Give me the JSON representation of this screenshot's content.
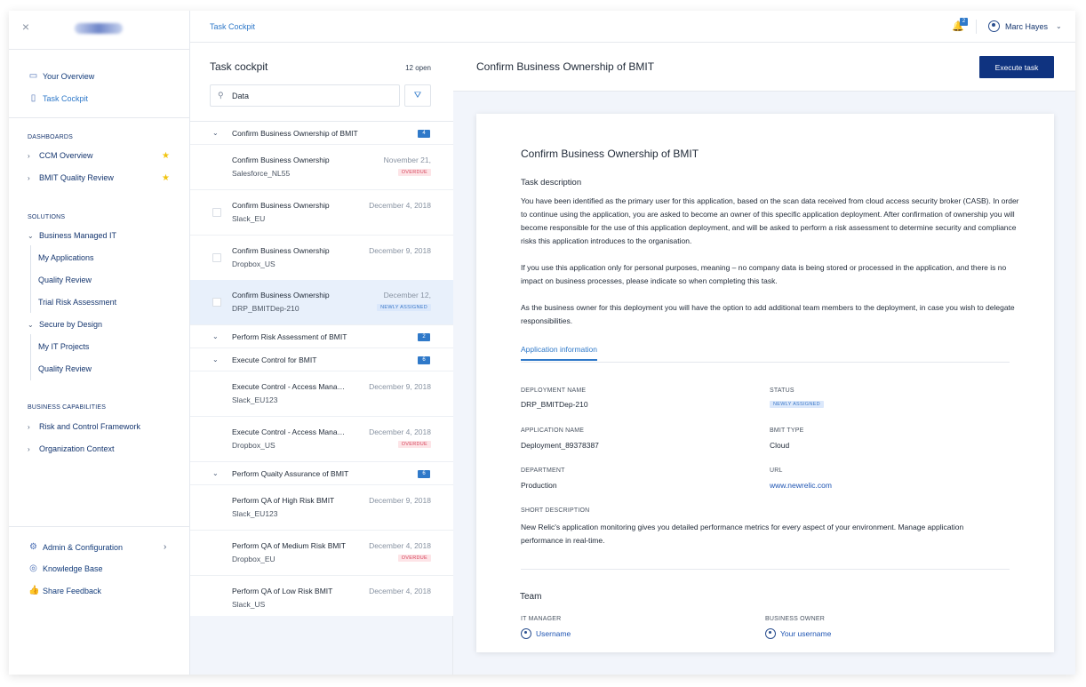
{
  "sidebar": {
    "close_icon": "×",
    "main_nav": [
      {
        "label": "Your Overview",
        "icon": "overview-icon"
      },
      {
        "label": "Task Cockpit",
        "icon": "task-icon"
      }
    ],
    "dashboards_heading": "DASHBOARDS",
    "dashboards": [
      {
        "label": "CCM Overview",
        "starred": true
      },
      {
        "label": "BMIT Quality Review",
        "starred": true
      }
    ],
    "solutions_heading": "SOLUTIONS",
    "solutions": {
      "business_managed_it": {
        "label": "Business Managed IT",
        "children": [
          "My Applications",
          "Quality Review",
          "Trial Risk Assessment"
        ]
      },
      "secure_by_design": {
        "label": "Secure by Design",
        "children": [
          "My IT Projects",
          "Quality Review"
        ]
      }
    },
    "capabilities_heading": "BUSINESS CAPABILITIES",
    "capabilities": [
      "Risk and Control Framework",
      "Organization Context"
    ],
    "footer": [
      {
        "label": "Admin & Configuration",
        "icon": "sliders-icon"
      },
      {
        "label": "Knowledge Base",
        "icon": "compass-icon"
      },
      {
        "label": "Share Feedback",
        "icon": "thumbs-up-icon"
      }
    ]
  },
  "header": {
    "breadcrumb": "Task Cockpit",
    "notification_count": "2",
    "user_name": "Marc Hayes"
  },
  "list": {
    "title": "Task cockpit",
    "count": "12 open",
    "search_value": "Data",
    "groups": [
      {
        "title": "Confirm Business Ownership of BMIT",
        "count": "4"
      },
      {
        "title": "Perform Risk Assessment of BMIT",
        "count": "2"
      },
      {
        "title": "Execute Control for BMIT",
        "count": "6"
      },
      {
        "title": "Perform Quaity Assurance of BMIT",
        "count": "6"
      }
    ],
    "items": [
      {
        "title": "Confirm Business Ownership",
        "sub": "Salesforce_NL55",
        "date": "November 21,",
        "badge": "OVERDUE"
      },
      {
        "title": "Confirm Business Ownership",
        "sub": "Slack_EU",
        "date": "December 4, 2018",
        "badge": ""
      },
      {
        "title": "Confirm Business Ownership",
        "sub": "Dropbox_US",
        "date": "December 9, 2018",
        "badge": ""
      },
      {
        "title": "Confirm Business Ownership",
        "sub": "DRP_BMITDep-210",
        "date": "December 12,",
        "badge": "NEWLY ASSIGNED"
      },
      {
        "title": "Execute Control - Access Management",
        "sub": "Slack_EU123",
        "date": "December 9, 2018",
        "badge": ""
      },
      {
        "title": "Execute Control - Access Management",
        "sub": "Dropbox_US",
        "date": "December 4, 2018",
        "badge": "OVERDUE"
      },
      {
        "title": "Perform QA of High Risk BMIT",
        "sub": "Slack_EU123",
        "date": "December 9, 2018",
        "badge": ""
      },
      {
        "title": "Perform QA of Medium Risk BMIT",
        "sub": "Dropbox_EU",
        "date": "December 4, 2018",
        "badge": "OVERDUE"
      },
      {
        "title": "Perform QA of Low Risk BMIT",
        "sub": "Slack_US",
        "date": "December 4, 2018",
        "badge": ""
      }
    ]
  },
  "detail": {
    "header_title": "Confirm Business Ownership of BMIT",
    "execute_label": "Execute task",
    "card_title": "Confirm Business Ownership of BMIT",
    "task_description_heading": "Task description",
    "para1": "You have been identified as the primary user for this application, based on the scan data received from cloud access security broker (CASB). In order to continue using the application, you are asked to become an owner of this specific application deployment. After confirmation of ownership you will become responsible for the use of this application deployment, and will be asked to perform a risk assessment to determine security and compliance risks this application introduces to the organisation.",
    "para2": "If you use this application only for personal purposes, meaning – no company data is being stored or processed in the application, and there is no impact on business processes, please indicate so when completing this task.",
    "para3": "As the business owner for this deployment you will have the option to add additional team members to the deployment, in case you wish to delegate responsibilities.",
    "tab_label": "Application information",
    "fields": {
      "deployment_name_label": "DEPLOYMENT NAME",
      "deployment_name": "DRP_BMITDep-210",
      "status_label": "STATUS",
      "status": "NEWLY ASSIGNED",
      "application_name_label": "APPLICATION NAME",
      "application_name": "Deployment_89378387",
      "bmit_type_label": "BMIT TYPE",
      "bmit_type": "Cloud",
      "department_label": "DEPARTMENT",
      "department": "Production",
      "url_label": "URL",
      "url": "www.newrelic.com",
      "short_description_label": "SHORT DESCRIPTION",
      "short_description": "New Relic's application monitoring gives you detailed performance metrics for every aspect of your environment. Manage application performance in real-time."
    },
    "team_heading": "Team",
    "it_manager_label": "IT MANAGER",
    "it_manager": "Username",
    "business_owner_label": "BUSINESS OWNER",
    "business_owner": "Your username"
  },
  "colors": {
    "accent": "#2f79c9",
    "primary_button": "#0f3380",
    "overdue": "#d6455c",
    "star": "#f1c40f"
  }
}
